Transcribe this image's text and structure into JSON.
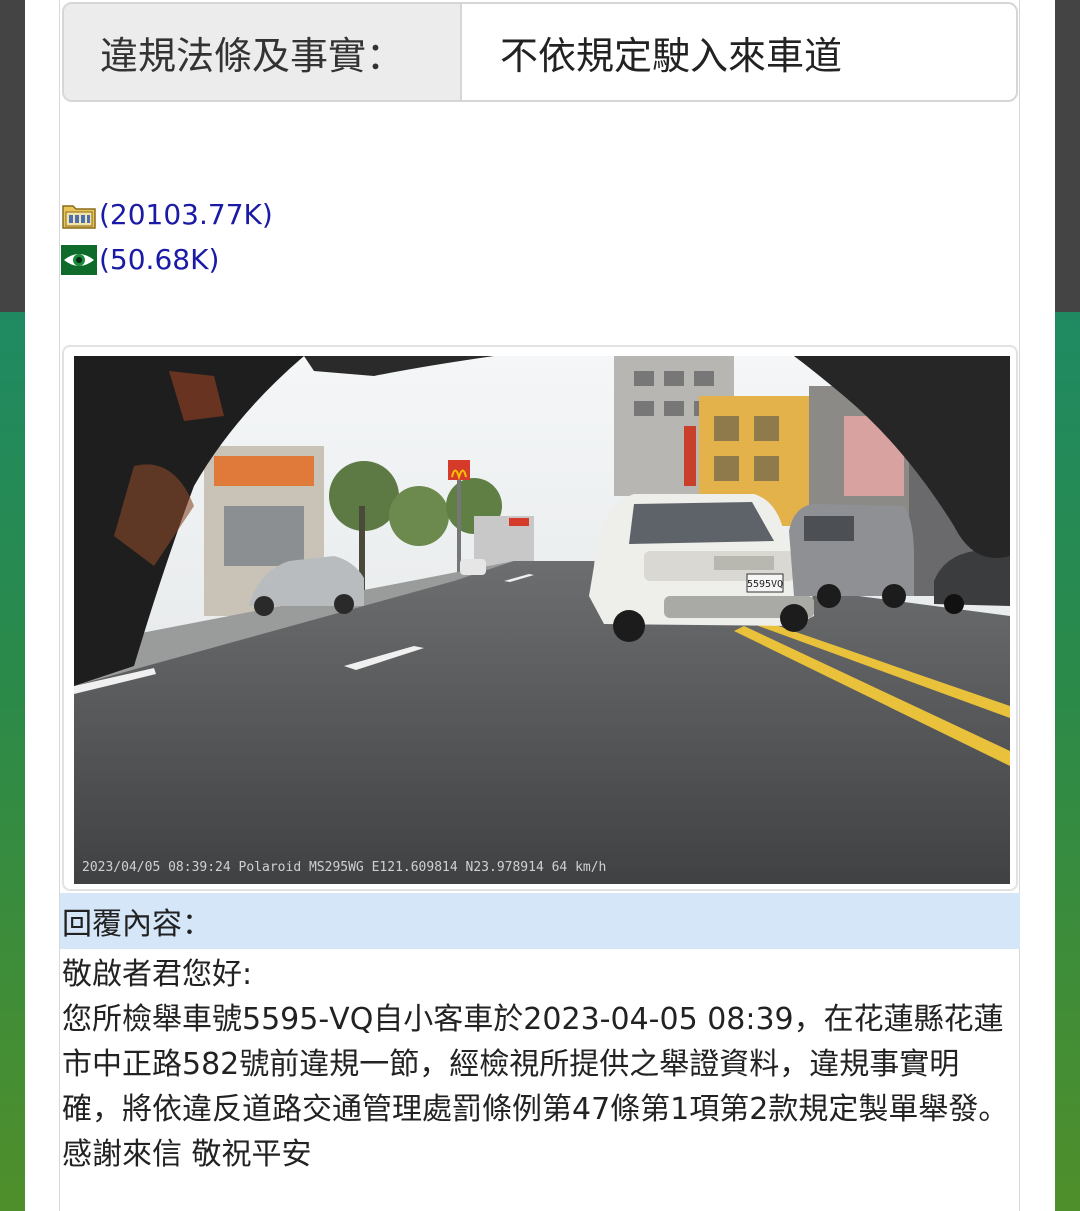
{
  "violation": {
    "label": "違規法條及事實：",
    "value": "不依規定駛入來車道"
  },
  "attachments": [
    {
      "icon": "video-file-icon",
      "size": "(20103.77K)"
    },
    {
      "icon": "eye-preview-icon",
      "size": "(50.68K)"
    }
  ],
  "photo": {
    "stamp": "2023/04/05 08:39:24 Polaroid MS295WG  E121.609814 N23.978914 64 km/h",
    "plate": "5595VQ"
  },
  "reply": {
    "header": "回覆內容：",
    "greeting": "敬啟者君您好:",
    "paragraph": "您所檢舉車號5595-VQ自小客車於2023-04-05 08:39，在花蓮縣花蓮市中正路582號前違規一節，經檢視所提供之舉證資料，違規事實明確，將依違反道路交通管理處罰條例第47條第1項第2款規定製單舉發。",
    "closing": "感謝來信 敬祝平安"
  }
}
